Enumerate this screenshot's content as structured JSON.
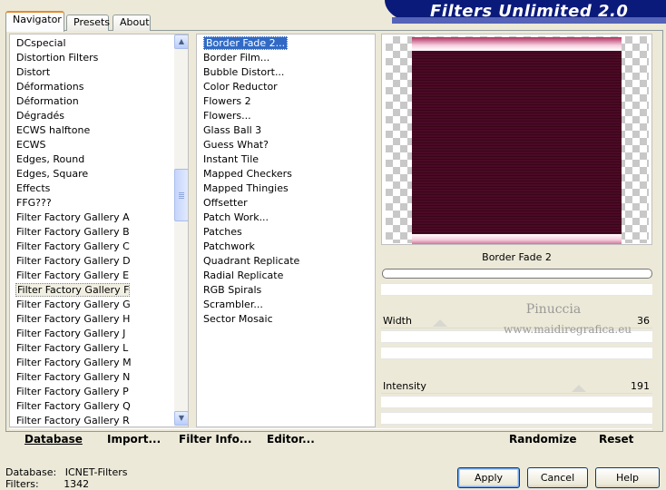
{
  "tabs": [
    {
      "label": "Navigator"
    },
    {
      "label": "Presets"
    },
    {
      "label": "About"
    }
  ],
  "banner": {
    "title": "Filters Unlimited 2.0"
  },
  "categories": [
    "DCspecial",
    "Distortion Filters",
    "Distort",
    "Déformations",
    "Déformation",
    "Dégradés",
    "ECWS halftone",
    "ECWS",
    "Edges, Round",
    "Edges, Square",
    "Effects",
    "FFG???",
    "Filter Factory Gallery A",
    "Filter Factory Gallery B",
    "Filter Factory Gallery C",
    "Filter Factory Gallery D",
    "Filter Factory Gallery E",
    "Filter Factory Gallery F",
    "Filter Factory Gallery G",
    "Filter Factory Gallery H",
    "Filter Factory Gallery J",
    "Filter Factory Gallery L",
    "Filter Factory Gallery M",
    "Filter Factory Gallery N",
    "Filter Factory Gallery P",
    "Filter Factory Gallery Q",
    "Filter Factory Gallery R"
  ],
  "selected_category": "Filter Factory Gallery F",
  "filters": [
    "Border Fade 2...",
    "Border Film...",
    "Bubble Distort...",
    "Color Reductor",
    "Flowers 2",
    "Flowers...",
    "Glass Ball 3",
    "Guess What?",
    "Instant Tile",
    "Mapped Checkers",
    "Mapped Thingies",
    "Offsetter",
    "Patch Work...",
    "Patches",
    "Patchwork",
    "Quadrant Replicate",
    "Radial Replicate",
    "RGB Spirals",
    "Scrambler...",
    "Sector Mosaic"
  ],
  "selected_filter": "Border Fade 2...",
  "preview": {
    "filter_name": "Border Fade 2",
    "progress": 0
  },
  "sliders": [
    {
      "label": "Width",
      "value": "36",
      "fraction": 0.14
    },
    {
      "label": "Intensity",
      "value": "191",
      "fraction": 0.75
    }
  ],
  "watermark": {
    "line1": "Pinuccia",
    "line2": "www.maidiregrafica.eu"
  },
  "bottom_buttons": {
    "database": "Database",
    "import": "Import...",
    "filter_info": "Filter Info...",
    "editor": "Editor...",
    "randomize": "Randomize",
    "reset": "Reset"
  },
  "info": {
    "database_label": "Database:",
    "database_value": "ICNET-Filters",
    "filters_label": "Filters:",
    "filters_value": "1342"
  },
  "dialog_buttons": {
    "apply": "Apply",
    "cancel": "Cancel",
    "help": "Help"
  }
}
